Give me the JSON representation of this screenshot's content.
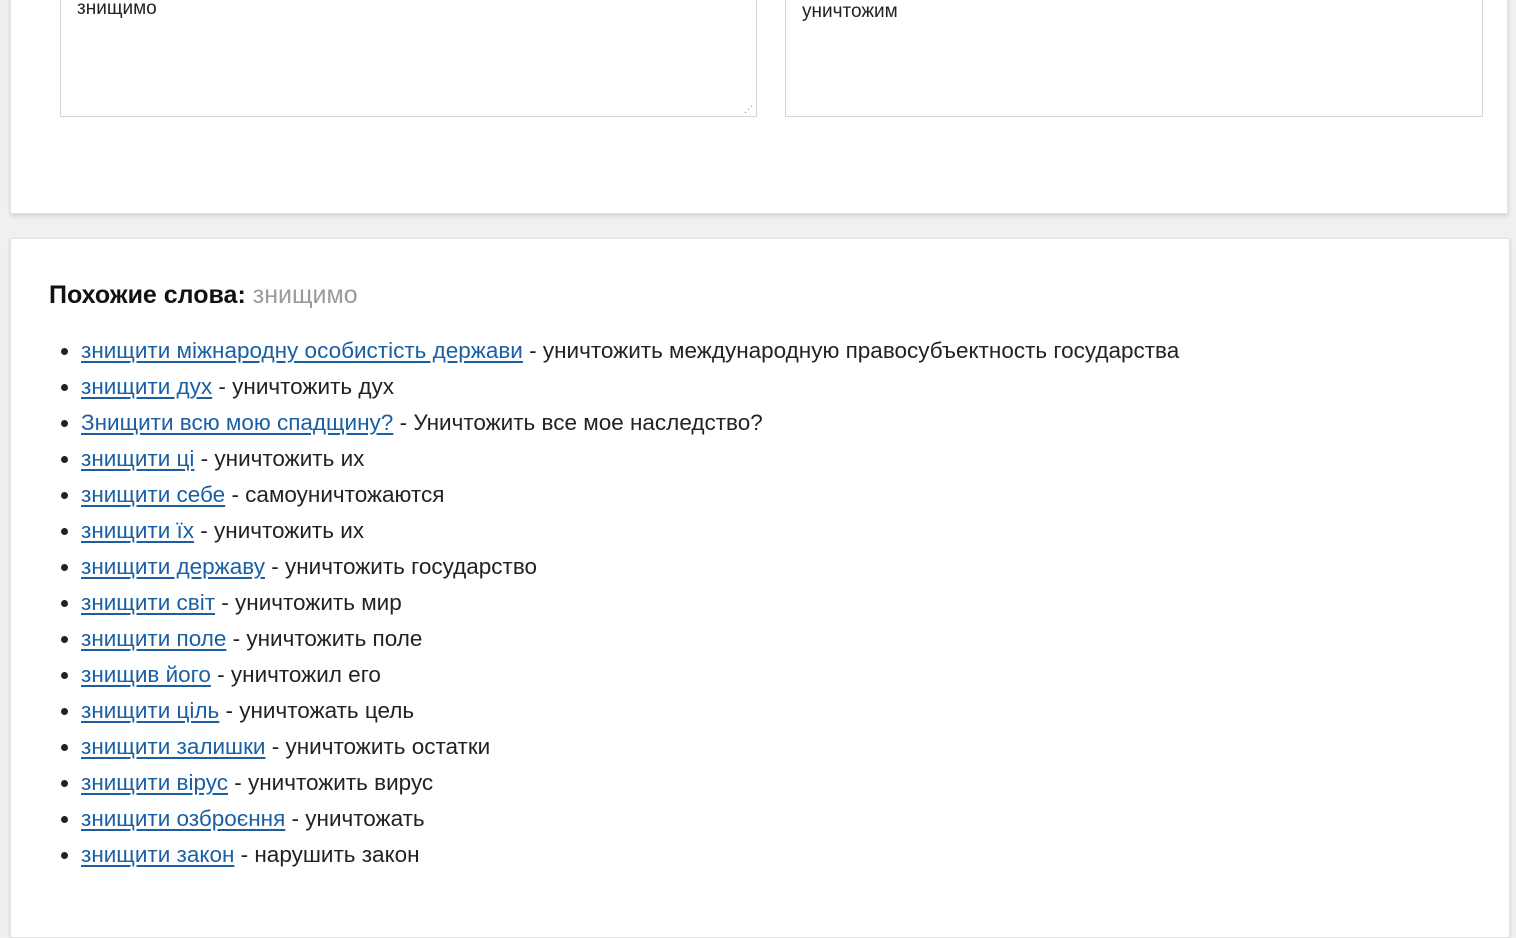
{
  "translator": {
    "source_text": "знищимо",
    "target_text": "уничтожим",
    "resize_glyph": "⋰"
  },
  "similar": {
    "label": "Похожие слова:",
    "word": "знищимо",
    "items": [
      {
        "phrase": "знищити міжнародну особистість держави",
        "translation": " - уничтожить международную правосубъектность государства"
      },
      {
        "phrase": "знищити дух",
        "translation": " - уничтожить дух"
      },
      {
        "phrase": "Знищити всю мою спадщину?",
        "translation": " - Уничтожить все мое наследство?"
      },
      {
        "phrase": "знищити ці",
        "translation": " - уничтожить их"
      },
      {
        "phrase": "знищити себе",
        "translation": " - самоуничтожаются"
      },
      {
        "phrase": "знищити їх",
        "translation": " - уничтожить их"
      },
      {
        "phrase": "знищити державу",
        "translation": " - уничтожить государство"
      },
      {
        "phrase": "знищити світ",
        "translation": " - уничтожить мир"
      },
      {
        "phrase": "знищити поле",
        "translation": " - уничтожить поле"
      },
      {
        "phrase": "знищив його",
        "translation": " - уничтожил его"
      },
      {
        "phrase": "знищити ціль",
        "translation": " - уничтожать цель"
      },
      {
        "phrase": "знищити залишки",
        "translation": " - уничтожить остатки"
      },
      {
        "phrase": "знищити вірус",
        "translation": " - уничтожить вирус"
      },
      {
        "phrase": "знищити озброєння",
        "translation": " - уничтожать"
      },
      {
        "phrase": "знищити закон",
        "translation": " - нарушить закон"
      }
    ]
  }
}
